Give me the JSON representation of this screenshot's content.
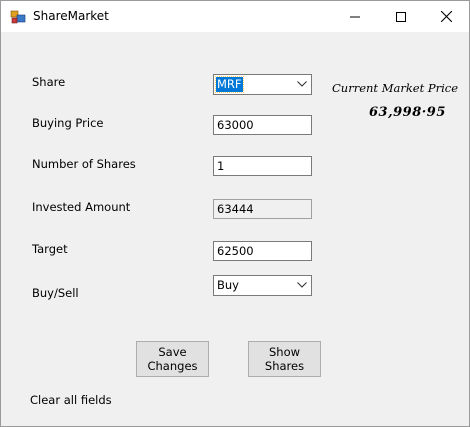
{
  "window": {
    "title": "ShareMarket",
    "icon": "app-icon",
    "controls": [
      "minimize-icon",
      "maximize-icon",
      "close-icon"
    ]
  },
  "form": {
    "share_label": "Share",
    "share_value": "MRF",
    "buying_price_label": "Buying Price",
    "buying_price_value": "63000",
    "num_shares_label": "Number of Shares",
    "num_shares_value": "1",
    "invested_label": "Invested Amount",
    "invested_value": "63444",
    "target_label": "Target",
    "target_value": "62500",
    "buysell_label": "Buy/Sell",
    "buysell_value": "Buy"
  },
  "market": {
    "label": "Current Market Price",
    "value": "63,998·95"
  },
  "buttons": {
    "save_line1": "Save",
    "save_line2": "Changes",
    "show_line1": "Show",
    "show_line2": "Shares"
  },
  "footer": {
    "clear_label": "Clear all fields"
  },
  "colors": {
    "selection": "#0078d7",
    "window_bg": "#f0f0f0",
    "titlebar_bg": "#ffffff"
  }
}
